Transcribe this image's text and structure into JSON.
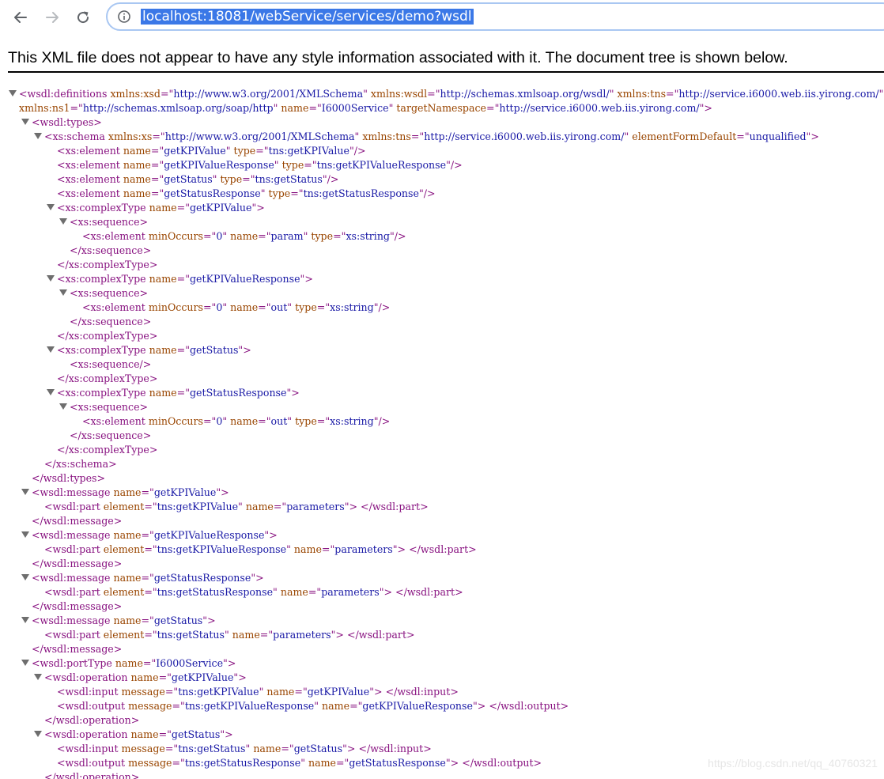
{
  "browser": {
    "url": "localhost:18081/webService/services/demo?wsdl",
    "back_icon": "arrow-left-icon",
    "forward_icon": "arrow-right-icon",
    "reload_icon": "reload-icon",
    "site_info_icon": "info-circle-icon"
  },
  "notice": "This XML file does not appear to have any style information associated with it. The document tree is shown below.",
  "watermark": "https://blog.csdn.net/qq_40760321",
  "colors": {
    "tag": "#881280",
    "attribute_name": "#994500",
    "attribute_value": "#1a1aa6",
    "selection": "#3b78e7",
    "omnibox_border": "#a9c7f2"
  },
  "xml_lines": [
    {
      "indent": 0,
      "toggle": true,
      "parts": [
        [
          "t",
          "<wsdl:definitions "
        ],
        [
          "n",
          "xmlns:xsd"
        ],
        [
          "t",
          "=\""
        ],
        [
          "v",
          "http://www.w3.org/2001/XMLSchema"
        ],
        [
          "t",
          "\" "
        ],
        [
          "n",
          "xmlns:wsdl"
        ],
        [
          "t",
          "=\""
        ],
        [
          "v",
          "http://schemas.xmlsoap.org/wsdl/"
        ],
        [
          "t",
          "\" "
        ],
        [
          "n",
          "xmlns:tns"
        ],
        [
          "t",
          "=\""
        ],
        [
          "v",
          "http://service.i6000.web.iis.yirong.com/"
        ],
        [
          "t",
          "\""
        ]
      ]
    },
    {
      "indent": 0,
      "toggle": false,
      "parts": [
        [
          "n",
          "xmlns:ns1"
        ],
        [
          "t",
          "=\""
        ],
        [
          "v",
          "http://schemas.xmlsoap.org/soap/http"
        ],
        [
          "t",
          "\" "
        ],
        [
          "n",
          "name"
        ],
        [
          "t",
          "=\""
        ],
        [
          "v",
          "I6000Service"
        ],
        [
          "t",
          "\" "
        ],
        [
          "n",
          "targetNamespace"
        ],
        [
          "t",
          "=\""
        ],
        [
          "v",
          "http://service.i6000.web.iis.yirong.com/"
        ],
        [
          "t",
          "\">"
        ]
      ]
    },
    {
      "indent": 1,
      "toggle": true,
      "parts": [
        [
          "t",
          "<wsdl:types>"
        ]
      ]
    },
    {
      "indent": 2,
      "toggle": true,
      "parts": [
        [
          "t",
          "<xs:schema "
        ],
        [
          "n",
          "xmlns:xs"
        ],
        [
          "t",
          "=\""
        ],
        [
          "v",
          "http://www.w3.org/2001/XMLSchema"
        ],
        [
          "t",
          "\" "
        ],
        [
          "n",
          "xmlns:tns"
        ],
        [
          "t",
          "=\""
        ],
        [
          "v",
          "http://service.i6000.web.iis.yirong.com/"
        ],
        [
          "t",
          "\" "
        ],
        [
          "n",
          "elementFormDefault"
        ],
        [
          "t",
          "=\""
        ],
        [
          "v",
          "unqualified"
        ],
        [
          "t",
          "\">"
        ]
      ]
    },
    {
      "indent": 3,
      "toggle": false,
      "parts": [
        [
          "t",
          "<xs:element "
        ],
        [
          "n",
          "name"
        ],
        [
          "t",
          "=\""
        ],
        [
          "v",
          "getKPIValue"
        ],
        [
          "t",
          "\" "
        ],
        [
          "n",
          "type"
        ],
        [
          "t",
          "=\""
        ],
        [
          "v",
          "tns:getKPIValue"
        ],
        [
          "t",
          "\"/>"
        ]
      ]
    },
    {
      "indent": 3,
      "toggle": false,
      "parts": [
        [
          "t",
          "<xs:element "
        ],
        [
          "n",
          "name"
        ],
        [
          "t",
          "=\""
        ],
        [
          "v",
          "getKPIValueResponse"
        ],
        [
          "t",
          "\" "
        ],
        [
          "n",
          "type"
        ],
        [
          "t",
          "=\""
        ],
        [
          "v",
          "tns:getKPIValueResponse"
        ],
        [
          "t",
          "\"/>"
        ]
      ]
    },
    {
      "indent": 3,
      "toggle": false,
      "parts": [
        [
          "t",
          "<xs:element "
        ],
        [
          "n",
          "name"
        ],
        [
          "t",
          "=\""
        ],
        [
          "v",
          "getStatus"
        ],
        [
          "t",
          "\" "
        ],
        [
          "n",
          "type"
        ],
        [
          "t",
          "=\""
        ],
        [
          "v",
          "tns:getStatus"
        ],
        [
          "t",
          "\"/>"
        ]
      ]
    },
    {
      "indent": 3,
      "toggle": false,
      "parts": [
        [
          "t",
          "<xs:element "
        ],
        [
          "n",
          "name"
        ],
        [
          "t",
          "=\""
        ],
        [
          "v",
          "getStatusResponse"
        ],
        [
          "t",
          "\" "
        ],
        [
          "n",
          "type"
        ],
        [
          "t",
          "=\""
        ],
        [
          "v",
          "tns:getStatusResponse"
        ],
        [
          "t",
          "\"/>"
        ]
      ]
    },
    {
      "indent": 3,
      "toggle": true,
      "parts": [
        [
          "t",
          "<xs:complexType "
        ],
        [
          "n",
          "name"
        ],
        [
          "t",
          "=\""
        ],
        [
          "v",
          "getKPIValue"
        ],
        [
          "t",
          "\">"
        ]
      ]
    },
    {
      "indent": 4,
      "toggle": true,
      "parts": [
        [
          "t",
          "<xs:sequence>"
        ]
      ]
    },
    {
      "indent": 5,
      "toggle": false,
      "parts": [
        [
          "t",
          "<xs:element "
        ],
        [
          "n",
          "minOccurs"
        ],
        [
          "t",
          "=\""
        ],
        [
          "v",
          "0"
        ],
        [
          "t",
          "\" "
        ],
        [
          "n",
          "name"
        ],
        [
          "t",
          "=\""
        ],
        [
          "v",
          "param"
        ],
        [
          "t",
          "\" "
        ],
        [
          "n",
          "type"
        ],
        [
          "t",
          "=\""
        ],
        [
          "v",
          "xs:string"
        ],
        [
          "t",
          "\"/>"
        ]
      ]
    },
    {
      "indent": 4,
      "toggle": false,
      "parts": [
        [
          "t",
          "</xs:sequence>"
        ]
      ]
    },
    {
      "indent": 3,
      "toggle": false,
      "parts": [
        [
          "t",
          "</xs:complexType>"
        ]
      ]
    },
    {
      "indent": 3,
      "toggle": true,
      "parts": [
        [
          "t",
          "<xs:complexType "
        ],
        [
          "n",
          "name"
        ],
        [
          "t",
          "=\""
        ],
        [
          "v",
          "getKPIValueResponse"
        ],
        [
          "t",
          "\">"
        ]
      ]
    },
    {
      "indent": 4,
      "toggle": true,
      "parts": [
        [
          "t",
          "<xs:sequence>"
        ]
      ]
    },
    {
      "indent": 5,
      "toggle": false,
      "parts": [
        [
          "t",
          "<xs:element "
        ],
        [
          "n",
          "minOccurs"
        ],
        [
          "t",
          "=\""
        ],
        [
          "v",
          "0"
        ],
        [
          "t",
          "\" "
        ],
        [
          "n",
          "name"
        ],
        [
          "t",
          "=\""
        ],
        [
          "v",
          "out"
        ],
        [
          "t",
          "\" "
        ],
        [
          "n",
          "type"
        ],
        [
          "t",
          "=\""
        ],
        [
          "v",
          "xs:string"
        ],
        [
          "t",
          "\"/>"
        ]
      ]
    },
    {
      "indent": 4,
      "toggle": false,
      "parts": [
        [
          "t",
          "</xs:sequence>"
        ]
      ]
    },
    {
      "indent": 3,
      "toggle": false,
      "parts": [
        [
          "t",
          "</xs:complexType>"
        ]
      ]
    },
    {
      "indent": 3,
      "toggle": true,
      "parts": [
        [
          "t",
          "<xs:complexType "
        ],
        [
          "n",
          "name"
        ],
        [
          "t",
          "=\""
        ],
        [
          "v",
          "getStatus"
        ],
        [
          "t",
          "\">"
        ]
      ]
    },
    {
      "indent": 4,
      "toggle": false,
      "parts": [
        [
          "t",
          "<xs:sequence/>"
        ]
      ]
    },
    {
      "indent": 3,
      "toggle": false,
      "parts": [
        [
          "t",
          "</xs:complexType>"
        ]
      ]
    },
    {
      "indent": 3,
      "toggle": true,
      "parts": [
        [
          "t",
          "<xs:complexType "
        ],
        [
          "n",
          "name"
        ],
        [
          "t",
          "=\""
        ],
        [
          "v",
          "getStatusResponse"
        ],
        [
          "t",
          "\">"
        ]
      ]
    },
    {
      "indent": 4,
      "toggle": true,
      "parts": [
        [
          "t",
          "<xs:sequence>"
        ]
      ]
    },
    {
      "indent": 5,
      "toggle": false,
      "parts": [
        [
          "t",
          "<xs:element "
        ],
        [
          "n",
          "minOccurs"
        ],
        [
          "t",
          "=\""
        ],
        [
          "v",
          "0"
        ],
        [
          "t",
          "\" "
        ],
        [
          "n",
          "name"
        ],
        [
          "t",
          "=\""
        ],
        [
          "v",
          "out"
        ],
        [
          "t",
          "\" "
        ],
        [
          "n",
          "type"
        ],
        [
          "t",
          "=\""
        ],
        [
          "v",
          "xs:string"
        ],
        [
          "t",
          "\"/>"
        ]
      ]
    },
    {
      "indent": 4,
      "toggle": false,
      "parts": [
        [
          "t",
          "</xs:sequence>"
        ]
      ]
    },
    {
      "indent": 3,
      "toggle": false,
      "parts": [
        [
          "t",
          "</xs:complexType>"
        ]
      ]
    },
    {
      "indent": 2,
      "toggle": false,
      "parts": [
        [
          "t",
          "</xs:schema>"
        ]
      ]
    },
    {
      "indent": 1,
      "toggle": false,
      "parts": [
        [
          "t",
          "</wsdl:types>"
        ]
      ]
    },
    {
      "indent": 1,
      "toggle": true,
      "parts": [
        [
          "t",
          "<wsdl:message "
        ],
        [
          "n",
          "name"
        ],
        [
          "t",
          "=\""
        ],
        [
          "v",
          "getKPIValue"
        ],
        [
          "t",
          "\">"
        ]
      ]
    },
    {
      "indent": 2,
      "toggle": false,
      "parts": [
        [
          "t",
          "<wsdl:part "
        ],
        [
          "n",
          "element"
        ],
        [
          "t",
          "=\""
        ],
        [
          "v",
          "tns:getKPIValue"
        ],
        [
          "t",
          "\" "
        ],
        [
          "n",
          "name"
        ],
        [
          "t",
          "=\""
        ],
        [
          "v",
          "parameters"
        ],
        [
          "t",
          "\"> </wsdl:part>"
        ]
      ]
    },
    {
      "indent": 1,
      "toggle": false,
      "parts": [
        [
          "t",
          "</wsdl:message>"
        ]
      ]
    },
    {
      "indent": 1,
      "toggle": true,
      "parts": [
        [
          "t",
          "<wsdl:message "
        ],
        [
          "n",
          "name"
        ],
        [
          "t",
          "=\""
        ],
        [
          "v",
          "getKPIValueResponse"
        ],
        [
          "t",
          "\">"
        ]
      ]
    },
    {
      "indent": 2,
      "toggle": false,
      "parts": [
        [
          "t",
          "<wsdl:part "
        ],
        [
          "n",
          "element"
        ],
        [
          "t",
          "=\""
        ],
        [
          "v",
          "tns:getKPIValueResponse"
        ],
        [
          "t",
          "\" "
        ],
        [
          "n",
          "name"
        ],
        [
          "t",
          "=\""
        ],
        [
          "v",
          "parameters"
        ],
        [
          "t",
          "\"> </wsdl:part>"
        ]
      ]
    },
    {
      "indent": 1,
      "toggle": false,
      "parts": [
        [
          "t",
          "</wsdl:message>"
        ]
      ]
    },
    {
      "indent": 1,
      "toggle": true,
      "parts": [
        [
          "t",
          "<wsdl:message "
        ],
        [
          "n",
          "name"
        ],
        [
          "t",
          "=\""
        ],
        [
          "v",
          "getStatusResponse"
        ],
        [
          "t",
          "\">"
        ]
      ]
    },
    {
      "indent": 2,
      "toggle": false,
      "parts": [
        [
          "t",
          "<wsdl:part "
        ],
        [
          "n",
          "element"
        ],
        [
          "t",
          "=\""
        ],
        [
          "v",
          "tns:getStatusResponse"
        ],
        [
          "t",
          "\" "
        ],
        [
          "n",
          "name"
        ],
        [
          "t",
          "=\""
        ],
        [
          "v",
          "parameters"
        ],
        [
          "t",
          "\"> </wsdl:part>"
        ]
      ]
    },
    {
      "indent": 1,
      "toggle": false,
      "parts": [
        [
          "t",
          "</wsdl:message>"
        ]
      ]
    },
    {
      "indent": 1,
      "toggle": true,
      "parts": [
        [
          "t",
          "<wsdl:message "
        ],
        [
          "n",
          "name"
        ],
        [
          "t",
          "=\""
        ],
        [
          "v",
          "getStatus"
        ],
        [
          "t",
          "\">"
        ]
      ]
    },
    {
      "indent": 2,
      "toggle": false,
      "parts": [
        [
          "t",
          "<wsdl:part "
        ],
        [
          "n",
          "element"
        ],
        [
          "t",
          "=\""
        ],
        [
          "v",
          "tns:getStatus"
        ],
        [
          "t",
          "\" "
        ],
        [
          "n",
          "name"
        ],
        [
          "t",
          "=\""
        ],
        [
          "v",
          "parameters"
        ],
        [
          "t",
          "\"> </wsdl:part>"
        ]
      ]
    },
    {
      "indent": 1,
      "toggle": false,
      "parts": [
        [
          "t",
          "</wsdl:message>"
        ]
      ]
    },
    {
      "indent": 1,
      "toggle": true,
      "parts": [
        [
          "t",
          "<wsdl:portType "
        ],
        [
          "n",
          "name"
        ],
        [
          "t",
          "=\""
        ],
        [
          "v",
          "I6000Service"
        ],
        [
          "t",
          "\">"
        ]
      ]
    },
    {
      "indent": 2,
      "toggle": true,
      "parts": [
        [
          "t",
          "<wsdl:operation "
        ],
        [
          "n",
          "name"
        ],
        [
          "t",
          "=\""
        ],
        [
          "v",
          "getKPIValue"
        ],
        [
          "t",
          "\">"
        ]
      ]
    },
    {
      "indent": 3,
      "toggle": false,
      "parts": [
        [
          "t",
          "<wsdl:input "
        ],
        [
          "n",
          "message"
        ],
        [
          "t",
          "=\""
        ],
        [
          "v",
          "tns:getKPIValue"
        ],
        [
          "t",
          "\" "
        ],
        [
          "n",
          "name"
        ],
        [
          "t",
          "=\""
        ],
        [
          "v",
          "getKPIValue"
        ],
        [
          "t",
          "\"> </wsdl:input>"
        ]
      ]
    },
    {
      "indent": 3,
      "toggle": false,
      "parts": [
        [
          "t",
          "<wsdl:output "
        ],
        [
          "n",
          "message"
        ],
        [
          "t",
          "=\""
        ],
        [
          "v",
          "tns:getKPIValueResponse"
        ],
        [
          "t",
          "\" "
        ],
        [
          "n",
          "name"
        ],
        [
          "t",
          "=\""
        ],
        [
          "v",
          "getKPIValueResponse"
        ],
        [
          "t",
          "\"> </wsdl:output>"
        ]
      ]
    },
    {
      "indent": 2,
      "toggle": false,
      "parts": [
        [
          "t",
          "</wsdl:operation>"
        ]
      ]
    },
    {
      "indent": 2,
      "toggle": true,
      "parts": [
        [
          "t",
          "<wsdl:operation "
        ],
        [
          "n",
          "name"
        ],
        [
          "t",
          "=\""
        ],
        [
          "v",
          "getStatus"
        ],
        [
          "t",
          "\">"
        ]
      ]
    },
    {
      "indent": 3,
      "toggle": false,
      "parts": [
        [
          "t",
          "<wsdl:input "
        ],
        [
          "n",
          "message"
        ],
        [
          "t",
          "=\""
        ],
        [
          "v",
          "tns:getStatus"
        ],
        [
          "t",
          "\" "
        ],
        [
          "n",
          "name"
        ],
        [
          "t",
          "=\""
        ],
        [
          "v",
          "getStatus"
        ],
        [
          "t",
          "\"> </wsdl:input>"
        ]
      ]
    },
    {
      "indent": 3,
      "toggle": false,
      "parts": [
        [
          "t",
          "<wsdl:output "
        ],
        [
          "n",
          "message"
        ],
        [
          "t",
          "=\""
        ],
        [
          "v",
          "tns:getStatusResponse"
        ],
        [
          "t",
          "\" "
        ],
        [
          "n",
          "name"
        ],
        [
          "t",
          "=\""
        ],
        [
          "v",
          "getStatusResponse"
        ],
        [
          "t",
          "\"> </wsdl:output>"
        ]
      ]
    },
    {
      "indent": 2,
      "toggle": false,
      "parts": [
        [
          "t",
          "</wsdl:operation>"
        ]
      ]
    }
  ]
}
